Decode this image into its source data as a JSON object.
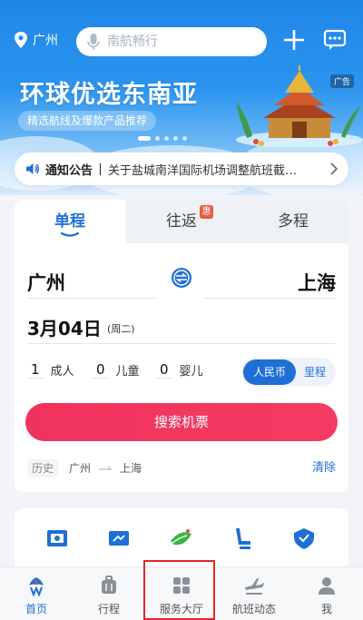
{
  "colors": {
    "primary": "#1f6fd6",
    "search_button": "#f0335e",
    "hot_badge": "#ee5a3f",
    "highlight": "#e0262b"
  },
  "header": {
    "location": "广州",
    "search_placeholder": "南航畅行"
  },
  "banner": {
    "title": "环球优选东南亚",
    "subtitle": "精选航线及爆款产品推荐",
    "ad_badge": "广告",
    "slide_count": 5,
    "active_slide": 1
  },
  "notice": {
    "label": "通知公告",
    "text": "关于盐城南洋国际机场调整航班截载..."
  },
  "booking": {
    "tabs": [
      {
        "label": "单程",
        "active": true
      },
      {
        "label": "往返",
        "badge": "惠",
        "active": false
      },
      {
        "label": "多程",
        "active": false
      }
    ],
    "from_city": "广州",
    "to_city": "上海",
    "date": "3月04日",
    "weekday": "(周二)",
    "passengers": [
      {
        "count": "1",
        "label": "成人"
      },
      {
        "count": "0",
        "label": "儿童"
      },
      {
        "count": "0",
        "label": "婴儿"
      }
    ],
    "currency": {
      "selected": "人民币",
      "other": "里程"
    },
    "search_label": "搜索机票",
    "history": {
      "tag": "历史",
      "from": "广州",
      "to": "上海",
      "clear_label": "清除"
    }
  },
  "services": [
    {
      "icon": "checkin-icon"
    },
    {
      "icon": "card-icon"
    },
    {
      "icon": "leaf-icon"
    },
    {
      "icon": "seat-icon"
    },
    {
      "icon": "shield-icon"
    }
  ],
  "bottom_nav": [
    {
      "label": "首页",
      "icon": "home-logo-icon",
      "active": true
    },
    {
      "label": "行程",
      "icon": "luggage-icon",
      "active": false
    },
    {
      "label": "服务大厅",
      "icon": "grid-icon",
      "active": false,
      "highlighted": true
    },
    {
      "label": "航班动态",
      "icon": "plane-icon",
      "active": false
    },
    {
      "label": "我",
      "icon": "person-icon",
      "active": false
    }
  ]
}
